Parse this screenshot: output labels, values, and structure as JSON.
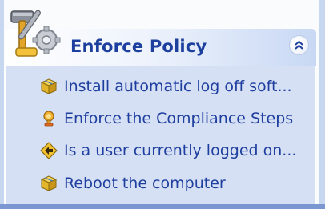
{
  "panel": {
    "title": "Enforce Policy",
    "collapse_icon": "double-chevron-up-icon",
    "header_icon": "tools-icon"
  },
  "tasks": [
    {
      "label": "Install automatic log off soft...",
      "icon": "package-icon"
    },
    {
      "label": "Enforce the Compliance Steps",
      "icon": "trophy-icon"
    },
    {
      "label": "Is a user currently logged on...",
      "icon": "diamond-arrow-icon"
    },
    {
      "label": "Reboot the computer",
      "icon": "package-icon"
    }
  ],
  "colors": {
    "title": "#1d3f9e",
    "link": "#1f3f9f",
    "body_bg": "#d6e0f5",
    "frame": "#7a97d2"
  }
}
